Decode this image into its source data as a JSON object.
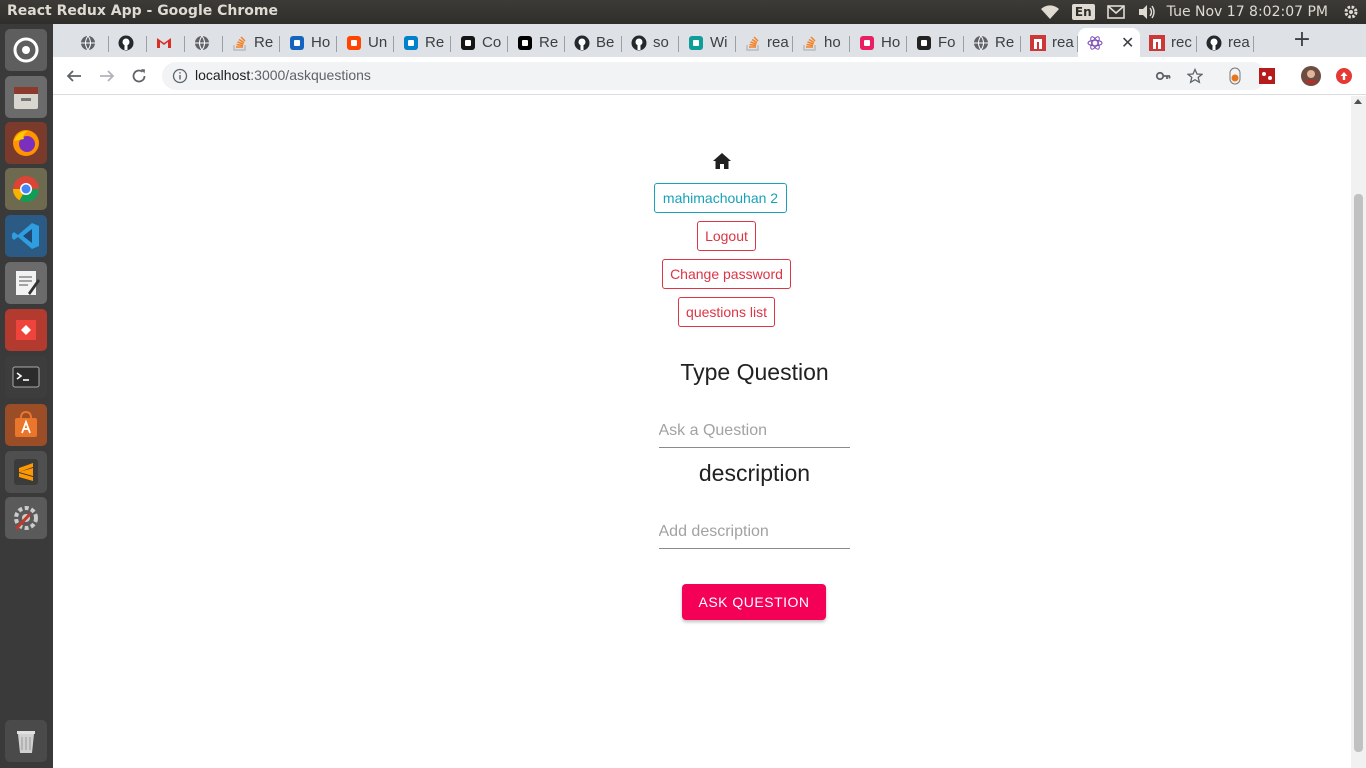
{
  "os": {
    "window_title": "React Redux App - Google Chrome",
    "keyboard_layout": "En",
    "clock": "Tue Nov 17  8:02:07 PM",
    "launcher_apps": [
      "dash",
      "files",
      "firefox",
      "chrome",
      "vscode",
      "text-editor",
      "anydesk",
      "terminal",
      "software-center",
      "sublime-text",
      "system-settings",
      "trash"
    ]
  },
  "browser": {
    "tabs": [
      {
        "label": "",
        "icon": "globe-icon"
      },
      {
        "label": "",
        "icon": "github-icon"
      },
      {
        "label": "",
        "icon": "gmail-icon"
      },
      {
        "label": "",
        "icon": "globe-icon"
      },
      {
        "label": "Re",
        "icon": "stackoverflow-icon"
      },
      {
        "label": "Ho",
        "icon": "monitor-icon"
      },
      {
        "label": "Un",
        "icon": "reddit-icon"
      },
      {
        "label": "Re",
        "icon": "material-ui-icon"
      },
      {
        "label": "Co",
        "icon": "codesandbox-icon"
      },
      {
        "label": "Re",
        "icon": "medium-icon"
      },
      {
        "label": "Be",
        "icon": "github-icon"
      },
      {
        "label": "so",
        "icon": "github-icon"
      },
      {
        "label": "Wi",
        "icon": "wikipedia-icon"
      },
      {
        "label": "rea",
        "icon": "stackoverflow-icon"
      },
      {
        "label": "ho",
        "icon": "stackoverflow-icon"
      },
      {
        "label": "Ho",
        "icon": "play-icon"
      },
      {
        "label": "Fo",
        "icon": "linux-icon"
      },
      {
        "label": "Re",
        "icon": "globe-icon"
      },
      {
        "label": "rea",
        "icon": "npm-icon"
      },
      {
        "label": "",
        "icon": "react-icon",
        "active": true
      },
      {
        "label": "rec",
        "icon": "npm-icon"
      },
      {
        "label": "rea",
        "icon": "github-icon"
      }
    ],
    "url": {
      "host": "localhost",
      "path": ":3000/askquestions"
    }
  },
  "page": {
    "home_icon": "home-icon",
    "user_button": "mahimachouhan 2",
    "logout_button": "Logout",
    "change_password_button": "Change password",
    "questions_list_button": "questions list",
    "question_heading": "Type Question",
    "question_placeholder": "Ask a Question",
    "question_value": "",
    "description_heading": "description",
    "description_placeholder": "Add description",
    "description_value": "",
    "submit_button": "ASK QUESTION",
    "colors": {
      "info": "#17a2b8",
      "danger": "#dc3545",
      "primary_action": "#f50057"
    }
  }
}
